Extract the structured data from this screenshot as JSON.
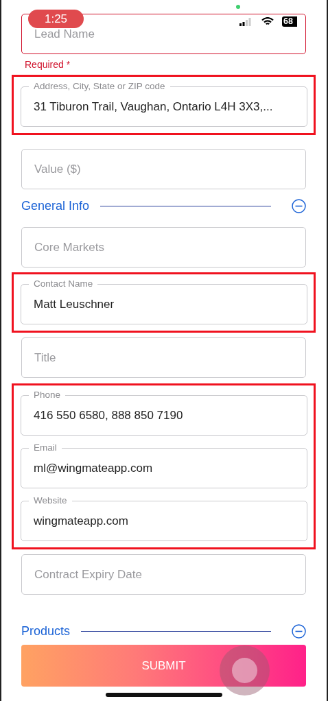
{
  "status_bar": {
    "time": "1:25",
    "battery": "68"
  },
  "blocks": [
    {
      "highlighted": false,
      "items": [
        {
          "kind": "field",
          "placeholder": "Lead Name",
          "error": true
        },
        {
          "kind": "error",
          "text": "Required *"
        }
      ]
    },
    {
      "highlighted": true,
      "items": [
        {
          "kind": "field",
          "label": "Address, City, State or ZIP code",
          "value": "31 Tiburon Trail, Vaughan, Ontario L4H 3X3,...",
          "error": false
        }
      ]
    },
    {
      "highlighted": false,
      "items": [
        {
          "kind": "field",
          "placeholder": "Value ($)",
          "error": false
        },
        {
          "kind": "section",
          "title": "General Info",
          "expanded": true
        },
        {
          "kind": "field",
          "placeholder": "Core Markets",
          "error": false
        }
      ]
    },
    {
      "highlighted": true,
      "items": [
        {
          "kind": "field",
          "label": "Contact Name",
          "value": "Matt Leuschner",
          "error": false
        }
      ]
    },
    {
      "highlighted": false,
      "items": [
        {
          "kind": "field",
          "placeholder": "Title",
          "error": false
        }
      ]
    },
    {
      "highlighted": true,
      "items": [
        {
          "kind": "field",
          "label": "Phone",
          "value": "416 550 6580, 888 850 7190",
          "error": false
        },
        {
          "kind": "field",
          "label": "Email",
          "value": "ml@wingmateapp.com",
          "error": false
        },
        {
          "kind": "field",
          "label": "Website",
          "value": "wingmateapp.com",
          "error": false
        }
      ]
    },
    {
      "highlighted": false,
      "items": [
        {
          "kind": "field",
          "placeholder": "Contract Expiry Date",
          "error": false
        },
        {
          "kind": "section",
          "title": "Products",
          "expanded": true
        }
      ]
    }
  ],
  "submit": {
    "label": "SUBMIT"
  }
}
